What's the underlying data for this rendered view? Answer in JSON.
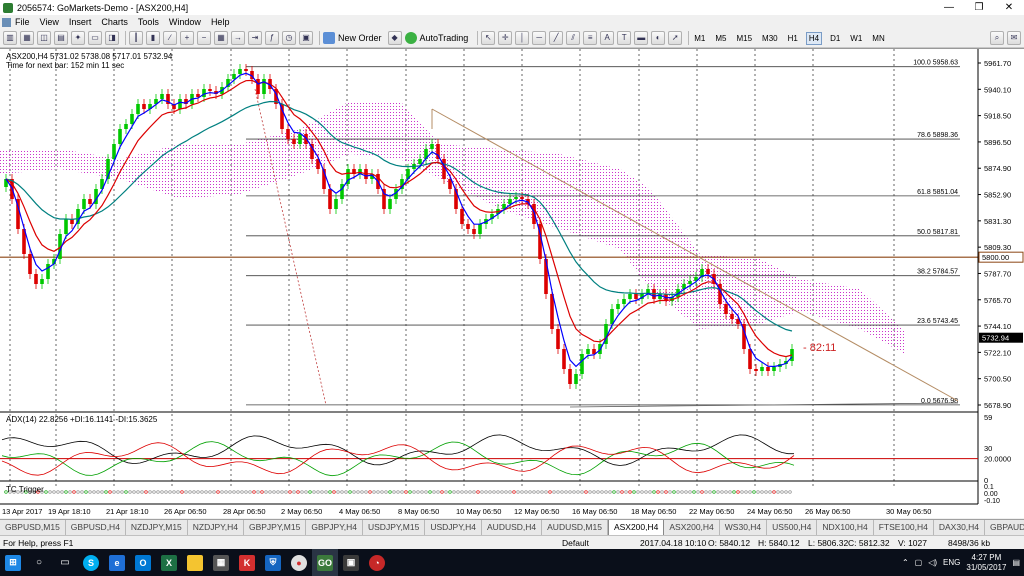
{
  "window": {
    "title": "2056574: GoMarkets-Demo - [ASX200,H4]",
    "minimize": "—",
    "restore": "❐",
    "close": "✕"
  },
  "menu": [
    "File",
    "View",
    "Insert",
    "Charts",
    "Tools",
    "Window",
    "Help"
  ],
  "toolbar": {
    "new_order": "New Order",
    "autotrading": "AutoTrading",
    "timeframes": [
      "M1",
      "M5",
      "M15",
      "M30",
      "H1",
      "H4",
      "D1",
      "W1",
      "MN"
    ],
    "active_timeframe": "H4",
    "draw_text": "A",
    "draw_label": "T"
  },
  "chart": {
    "symbol_line": "ASX200,H4  5731.02 5738.08 5717.01 5732.94",
    "timer_line": "Time for next bar: 152 min 11 sec",
    "countdown_label": "- 82:11",
    "price_axis": [
      "5961.70",
      "5940.10",
      "5918.50",
      "5896.50",
      "5874.90",
      "5852.90",
      "5831.30",
      "5809.30",
      "5787.70",
      "5765.70",
      "5744.10",
      "5722.10",
      "5700.50",
      "5678.90"
    ],
    "current_price": "5732.94",
    "level_price": "5800.00",
    "fib_levels": [
      {
        "label": "100.0  5958.63",
        "price": 5958.63
      },
      {
        "label": "78.6  5898.36",
        "price": 5898.36
      },
      {
        "label": "61.8  5851.04",
        "price": 5851.04
      },
      {
        "label": "50.0  5817.81",
        "price": 5817.81
      },
      {
        "label": "38.2  5784.57",
        "price": 5784.57
      },
      {
        "label": "23.6  5743.45",
        "price": 5743.45
      },
      {
        "label": "0.0  5676.98",
        "price": 5676.98
      }
    ],
    "time_axis": [
      "13 Apr 2017",
      "19 Apr 18:10",
      "21 Apr 18:10",
      "26 Apr 06:50",
      "28 Apr 06:50",
      "2 May 06:50",
      "4 May 06:50",
      "8 May 06:50",
      "10 May 06:50",
      "12 May 06:50",
      "16 May 06:50",
      "18 May 06:50",
      "22 May 06:50",
      "24 May 06:50",
      "26 May 06:50",
      "30 May 06:50"
    ]
  },
  "adx": {
    "label": "ADX(14) 22.8256 +DI:16.1141 -DI:15.3625",
    "axis": [
      "59",
      "30",
      "20.0000",
      "0"
    ],
    "level": "20.0000"
  },
  "tc": {
    "label": "TC Trigger",
    "axis": [
      "0.1",
      "0.00",
      "-0.10"
    ]
  },
  "tabs": [
    "GBPUSD,M15",
    "GBPUSD,H4",
    "NZDJPY,M15",
    "NZDJPY,H4",
    "GBPJPY,M15",
    "GBPJPY,H4",
    "USDJPY,M15",
    "USDJPY,H4",
    "AUDUSD,H4",
    "AUDUSD,M15",
    "ASX200,H4",
    "ASX200,H4",
    "WS30,H4",
    "US500,H4",
    "NDX100,H4",
    "FTSE100,H4",
    "DAX30,H4",
    "GBPAUD,M15"
  ],
  "active_tab": "ASX200,H4",
  "status": {
    "help": "For Help, press F1",
    "profile": "Default",
    "datetime": "2017.04.18 10:10",
    "open": "O: 5840.12",
    "high": "H: 5840.12",
    "low": "L: 5806.32",
    "close": "C: 5812.32",
    "volume": "V: 1027",
    "traffic": "8498/36 kb"
  },
  "taskbar": {
    "lang": "ENG",
    "time": "4:27 PM",
    "date": "31/05/2017"
  },
  "colors": {
    "candle_up": "#00c800",
    "candle_down": "#dc0000",
    "ema_fast": "#0000ff",
    "ema_mid": "#dc0000",
    "ema_slow": "#008080",
    "cloud": "#cc33cc",
    "trendline": "#b48c64",
    "level": "#8b4513",
    "fib": "#404040"
  }
}
